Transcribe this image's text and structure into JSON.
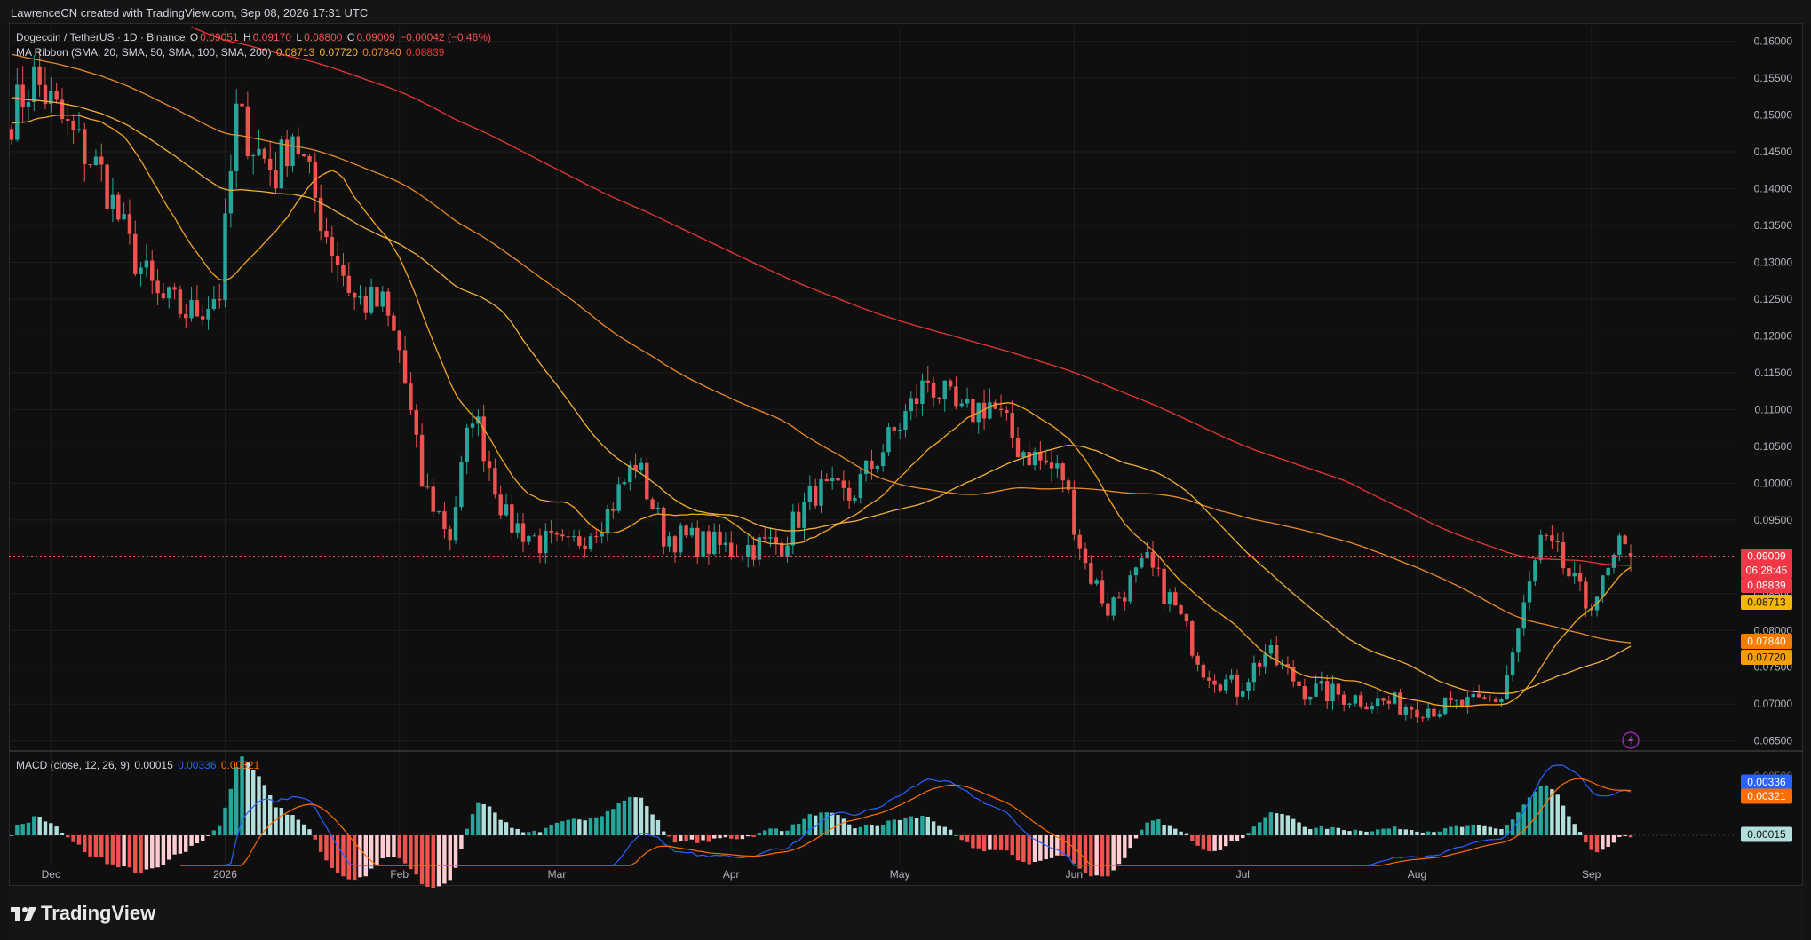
{
  "header": {
    "attribution": "LawrenceCN created with TradingView.com, Sep 08, 2026 17:31 UTC"
  },
  "legend": {
    "symbol": "Dogecoin / TetherUS · 1D · Binance",
    "o_label": "O",
    "o_value": "0.09051",
    "h_label": "H",
    "h_value": "0.09170",
    "l_label": "L",
    "l_value": "0.08800",
    "c_label": "C",
    "c_value": "0.09009",
    "change": "−0.00042 (−0.46%)",
    "ribbon_label": "MA Ribbon (SMA, 20, SMA, 50, SMA, 100, SMA, 200)",
    "ribbon_values": [
      "0.08713",
      "0.07720",
      "0.07840",
      "0.08839"
    ],
    "macd_label": "MACD (close, 12, 26, 9)",
    "macd_values": [
      "0.00015",
      "0.00336",
      "0.00321"
    ]
  },
  "colors": {
    "up": "#26a69a",
    "down": "#ef5350",
    "sma20": "#f5a623",
    "sma50": "#f0b03a",
    "sma100": "#e98a2b",
    "sma200": "#e53935",
    "macd": "#2962ff",
    "signal": "#ff6d00",
    "hist_up_strong": "#26a69a",
    "hist_up_weak": "#b2dfdb",
    "hist_down_strong": "#ef5350",
    "hist_down_weak": "#ffcdd2"
  },
  "price_axis": {
    "ticks": [
      "0.16000",
      "0.15500",
      "0.15000",
      "0.14500",
      "0.14000",
      "0.13500",
      "0.13000",
      "0.12500",
      "0.12000",
      "0.11500",
      "0.11000",
      "0.10500",
      "0.10000",
      "0.09500",
      "0.09000",
      "0.08500",
      "0.08000",
      "0.07500",
      "0.07000",
      "0.06500"
    ],
    "last_price": "0.09009",
    "countdown": "06:28:45",
    "tags": [
      "0.08839",
      "0.08713",
      "0.07840",
      "0.07720"
    ]
  },
  "macd_axis": {
    "top_tick": "0.00500",
    "tags": [
      "0.00336",
      "0.00321",
      "0.00015"
    ]
  },
  "time_axis": {
    "labels": [
      "Dec",
      "2026",
      "Feb",
      "Mar",
      "Apr",
      "May",
      "Jun",
      "Jul",
      "Aug",
      "Sep"
    ]
  },
  "footer": {
    "brand": "TradingView"
  },
  "chart_data": {
    "type": "candlestick",
    "title": "Dogecoin / TetherUS · 1D · Binance",
    "ylim": [
      0.064,
      0.162
    ],
    "x_range": [
      "2025-11-24",
      "2026-09-08"
    ],
    "keypoints": [
      [
        "2025-11-24",
        0.15
      ],
      [
        "2025-11-28",
        0.155
      ],
      [
        "2025-12-04",
        0.148
      ],
      [
        "2025-12-10",
        0.142
      ],
      [
        "2025-12-15",
        0.132
      ],
      [
        "2025-12-20",
        0.125
      ],
      [
        "2025-12-26",
        0.123
      ],
      [
        "2025-12-31",
        0.126
      ],
      [
        "2026-01-03",
        0.15
      ],
      [
        "2026-01-06",
        0.146
      ],
      [
        "2026-01-10",
        0.142
      ],
      [
        "2026-01-13",
        0.148
      ],
      [
        "2026-01-19",
        0.134
      ],
      [
        "2026-01-24",
        0.125
      ],
      [
        "2026-01-29",
        0.124
      ],
      [
        "2026-02-01",
        0.118
      ],
      [
        "2026-02-05",
        0.1
      ],
      [
        "2026-02-10",
        0.093
      ],
      [
        "2026-02-14",
        0.11
      ],
      [
        "2026-02-20",
        0.095
      ],
      [
        "2026-02-26",
        0.092
      ],
      [
        "2026-03-03",
        0.091
      ],
      [
        "2026-03-10",
        0.096
      ],
      [
        "2026-03-15",
        0.103
      ],
      [
        "2026-03-20",
        0.093
      ],
      [
        "2026-04-01",
        0.091
      ],
      [
        "2026-04-10",
        0.092
      ],
      [
        "2026-04-16",
        0.099
      ],
      [
        "2026-04-22",
        0.098
      ],
      [
        "2026-05-01",
        0.108
      ],
      [
        "2026-05-06",
        0.114
      ],
      [
        "2026-05-12",
        0.109
      ],
      [
        "2026-05-17",
        0.111
      ],
      [
        "2026-05-22",
        0.105
      ],
      [
        "2026-05-30",
        0.101
      ],
      [
        "2026-06-03",
        0.089
      ],
      [
        "2026-06-07",
        0.083
      ],
      [
        "2026-06-14",
        0.089
      ],
      [
        "2026-06-19",
        0.083
      ],
      [
        "2026-06-24",
        0.075
      ],
      [
        "2026-06-30",
        0.072
      ],
      [
        "2026-07-05",
        0.077
      ],
      [
        "2026-07-12",
        0.072
      ],
      [
        "2026-07-20",
        0.071
      ],
      [
        "2026-07-28",
        0.07
      ],
      [
        "2026-08-05",
        0.0695
      ],
      [
        "2026-08-12",
        0.07
      ],
      [
        "2026-08-16",
        0.071
      ],
      [
        "2026-08-19",
        0.08
      ],
      [
        "2026-08-23",
        0.092
      ],
      [
        "2026-08-26",
        0.09
      ],
      [
        "2026-08-31",
        0.0835
      ],
      [
        "2026-09-03",
        0.086
      ],
      [
        "2026-09-06",
        0.091
      ],
      [
        "2026-09-08",
        0.09009
      ]
    ],
    "ma_ribbon_last": {
      "SMA20": 0.08713,
      "SMA50": 0.0772,
      "SMA100": 0.0784,
      "SMA200": 0.08839
    },
    "macd_last": {
      "histogram": 0.00015,
      "macd": 0.00336,
      "signal": 0.00321
    }
  }
}
